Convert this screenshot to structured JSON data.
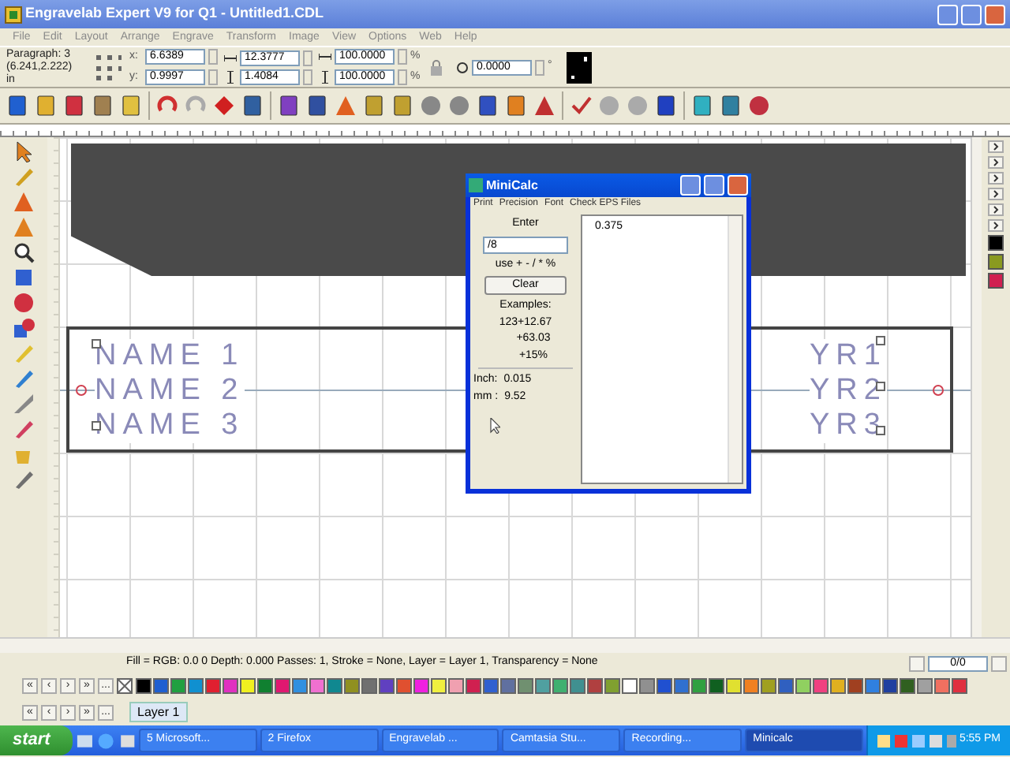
{
  "window": {
    "title": "Engravelab Expert V9 for Q1 - Untitled1.CDL"
  },
  "menu": [
    "File",
    "Edit",
    "Layout",
    "Arrange",
    "Engrave",
    "Transform",
    "Image",
    "View",
    "Options",
    "Web",
    "Help"
  ],
  "property_bar": {
    "selection": "Paragraph: 3",
    "position": "(6.241,2.222)",
    "units": "in",
    "fields": [
      {
        "label": "x:",
        "value": "6.6389"
      },
      {
        "label": "y:",
        "value": "0.9997"
      }
    ],
    "sizes": [
      {
        "value": "12.3777"
      },
      {
        "value": "1.4084"
      }
    ],
    "scales": [
      {
        "value": "100.0000",
        "unit": "%"
      },
      {
        "value": "100.0000",
        "unit": "%"
      }
    ],
    "rotation": {
      "value": "0.0000",
      "unit": "°"
    }
  },
  "canvas": {
    "names": [
      "NAME 1",
      "NAME 2",
      "NAME 3"
    ],
    "years": [
      "YR1",
      "YR2",
      "YR3"
    ]
  },
  "minicalc": {
    "title": "MiniCalc",
    "menu": [
      "Print",
      "Precision",
      "Font",
      "Check EPS Files"
    ],
    "enter_label": "Enter",
    "input": "/8",
    "hint": "use + - / * %",
    "clear": "Clear",
    "examples_title": "Examples:",
    "examples": [
      "123+12.67",
      "+63.03",
      "+15%"
    ],
    "conversions": [
      {
        "label": "Inch:",
        "value": "0.015"
      },
      {
        "label": "mm :",
        "value": "9.52"
      }
    ],
    "results": [
      "0.375"
    ]
  },
  "status_bar": {
    "text": "Fill = RGB: 0.0 0 Depth: 0.000 Passes: 1, Stroke = None, Layer = Layer 1, Transparency = None",
    "page": "0/0"
  },
  "palette": {
    "nav": [
      "«",
      "‹",
      "›",
      "»",
      "..."
    ],
    "swatches": [
      {
        "color": "#000000"
      },
      {
        "color": "#1f5fd0"
      },
      {
        "color": "#20a040"
      },
      {
        "color": "#1090d0"
      },
      {
        "color": "#e02030"
      },
      {
        "color": "#e030c0"
      },
      {
        "color": "#f0f020"
      },
      {
        "color": "#108030"
      },
      {
        "color": "#e01870"
      },
      {
        "color": "#3090e0"
      },
      {
        "color": "#f070d0"
      },
      {
        "color": "#108890"
      },
      {
        "color": "#909020"
      },
      {
        "color": "#707070"
      },
      {
        "color": "#6040c0"
      },
      {
        "color": "#e05030"
      },
      {
        "color": "#f020e0"
      },
      {
        "color": "#f0f040"
      },
      {
        "color": "#f0a0b0"
      },
      {
        "color": "#d02050"
      },
      {
        "color": "#3060d0"
      },
      {
        "color": "#6070a0"
      },
      {
        "color": "#709070"
      },
      {
        "color": "#50a0a0"
      },
      {
        "color": "#40b070"
      },
      {
        "color": "#409090"
      },
      {
        "color": "#b04040"
      },
      {
        "color": "#80a030"
      },
      {
        "color": "#ffffff"
      },
      {
        "color": "#909090"
      },
      {
        "color": "#2050d0"
      },
      {
        "color": "#3070d0"
      },
      {
        "color": "#30a040"
      },
      {
        "color": "#106020"
      },
      {
        "color": "#e0e030"
      },
      {
        "color": "#f08020"
      },
      {
        "color": "#a0a020"
      },
      {
        "color": "#3060c0"
      },
      {
        "color": "#90d060"
      },
      {
        "color": "#f04080"
      },
      {
        "color": "#e0b020"
      },
      {
        "color": "#a04020"
      },
      {
        "color": "#3080e0"
      },
      {
        "color": "#2040a0"
      },
      {
        "color": "#306020"
      },
      {
        "color": "#a0a0a0"
      },
      {
        "color": "#f07060"
      },
      {
        "color": "#e03040"
      }
    ]
  },
  "layers": {
    "nav": [
      "«",
      "‹",
      "›",
      "»",
      "..."
    ],
    "items": [
      {
        "label": "Layer 1",
        "selected": true
      }
    ]
  },
  "taskbar": {
    "start": "start",
    "tasks": [
      {
        "label": "5 Microsoft...",
        "selected": false
      },
      {
        "label": "2 Firefox",
        "selected": false
      },
      {
        "label": "Engravelab ...",
        "selected": false
      },
      {
        "label": "Camtasia Stu...",
        "selected": false
      },
      {
        "label": "Recording...",
        "selected": false
      },
      {
        "label": "Minicalc",
        "selected": true
      }
    ],
    "clock": "5:55 PM"
  }
}
